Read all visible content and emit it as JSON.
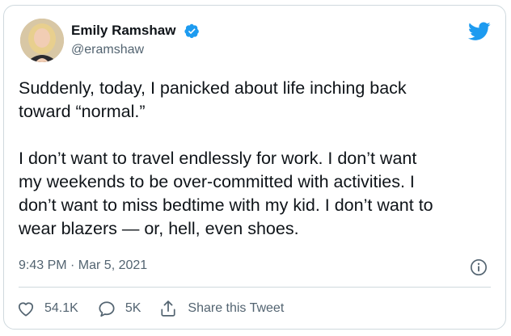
{
  "author": {
    "name": "Emily Ramshaw",
    "handle": "@eramshaw",
    "verified": true,
    "avatar_icon": "profile-photo"
  },
  "brand": {
    "icon": "twitter-bird-icon",
    "color": "#1d9bf0"
  },
  "tweet": {
    "lines": [
      "Suddenly, today, I panicked about life inching back",
      "toward “normal.”",
      "",
      "I don’t want to travel endlessly for work. I don’t want",
      "my weekends to be over-committed with activities. I",
      "don’t want to miss bedtime with my kid. I don’t want to",
      "wear blazers — or, hell, even shoes."
    ],
    "timestamp": "9:43 PM · Mar 5, 2021"
  },
  "actions": {
    "likes": "54.1K",
    "replies": "5K",
    "share_label": "Share this Tweet"
  },
  "colors": {
    "text_primary": "#0f1419",
    "text_secondary": "#536471",
    "border": "#cfd9de"
  }
}
